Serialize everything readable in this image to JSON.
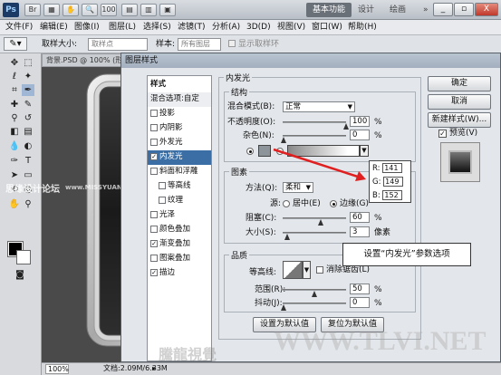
{
  "app": {
    "logo": "Ps",
    "workspaces": [
      "基本功能",
      "设计",
      "绘画"
    ],
    "window_controls": [
      "_",
      "▫",
      "X"
    ]
  },
  "menubar": [
    "文件(F)",
    "编辑(E)",
    "图像(I)",
    "图层(L)",
    "选择(S)",
    "滤镜(T)",
    "分析(A)",
    "3D(D)",
    "视图(V)",
    "窗口(W)",
    "帮助(H)"
  ],
  "options": {
    "sample_size_label": "取样大小:",
    "sample_size_value": "取样点",
    "sample_label": "样本:",
    "sample_value": "所有图层",
    "show_ring_label": "显示取样环"
  },
  "document": {
    "tab_label": "背景.PSD @ 100% (形状 1",
    "zoom": "100%",
    "doc_size": "文档:2.09M/6.33M"
  },
  "dialog": {
    "title": "图层样式",
    "style_list_header": "样式",
    "blend_default": "混合选项:自定",
    "styles": [
      {
        "label": "投影",
        "checked": false
      },
      {
        "label": "内阴影",
        "checked": false
      },
      {
        "label": "外发光",
        "checked": false
      },
      {
        "label": "内发光",
        "checked": true,
        "selected": true
      },
      {
        "label": "斜面和浮雕",
        "checked": false
      },
      {
        "label": "等高线",
        "checked": false,
        "indent": true
      },
      {
        "label": "纹理",
        "checked": false,
        "indent": true
      },
      {
        "label": "光泽",
        "checked": false
      },
      {
        "label": "颜色叠加",
        "checked": false
      },
      {
        "label": "渐变叠加",
        "checked": true
      },
      {
        "label": "图案叠加",
        "checked": false
      },
      {
        "label": "描边",
        "checked": true
      }
    ],
    "panel_title": "内发光",
    "structure": {
      "legend": "结构",
      "blend_mode_label": "混合模式(B):",
      "blend_mode_value": "正常",
      "opacity_label": "不透明度(O):",
      "opacity_value": "100",
      "opacity_unit": "%",
      "noise_label": "杂色(N):",
      "noise_value": "0",
      "noise_unit": "%",
      "glow_color": "#8d959a"
    },
    "elements": {
      "legend": "图素",
      "method_label": "方法(Q):",
      "method_value": "柔和",
      "source_label": "源:",
      "center_label": "居中(E)",
      "edge_label": "边缘(G)",
      "choke_label": "阻塞(C):",
      "choke_value": "60",
      "choke_unit": "%",
      "size_label": "大小(S):",
      "size_value": "3",
      "size_unit": "像素"
    },
    "quality": {
      "legend": "品质",
      "contour_label": "等高线:",
      "antialias_label": "消除锯齿(L)",
      "range_label": "范围(R):",
      "range_value": "50",
      "range_unit": "%",
      "jitter_label": "抖动(J):",
      "jitter_value": "0",
      "jitter_unit": "%"
    },
    "buttons": {
      "make_default": "设置为默认值",
      "reset_default": "复位为默认值",
      "ok": "确定",
      "cancel": "取消",
      "new_style": "新建样式(W)...",
      "preview": "预览(V)"
    }
  },
  "callouts": {
    "r_label": "R:",
    "r_value": "141",
    "g_label": "G:",
    "g_value": "149",
    "b_label": "B:",
    "b_value": "152",
    "note": "设置“内发光”参数选项"
  },
  "watermarks": {
    "left": "思缘设计论坛",
    "left_url": "www.MISSYUAN.COM",
    "brand": "騰龍視覺",
    "url": "WWW.TLVI.NET"
  },
  "colors": {
    "accent": "#3a6ea5",
    "arrow": "#e02020"
  }
}
